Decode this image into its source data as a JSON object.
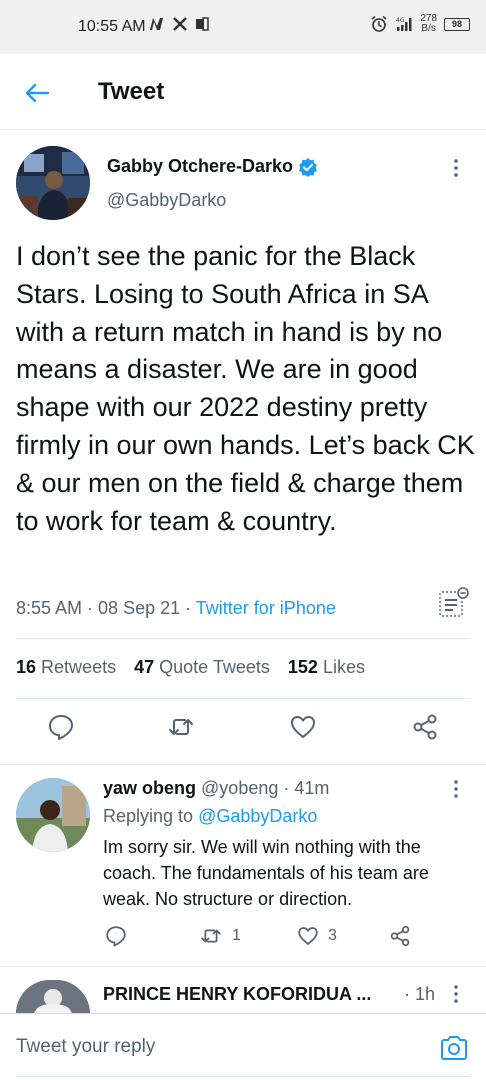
{
  "status_bar": {
    "time": "10:55 AM",
    "network_speed_value": "278",
    "network_speed_unit": "B/s",
    "battery": "98",
    "signal_label": "4G"
  },
  "header": {
    "title": "Tweet"
  },
  "tweet": {
    "author_name": "Gabby Otchere-Darko",
    "author_handle": "@GabbyDarko",
    "text": "I don’t see the panic for the Black Stars. Losing to South Africa in SA with a return match in hand is by no means a disaster. We are in good shape with our 2022 destiny pretty firmly in our own hands. Let’s back CK & our men on the field & charge them to work for team & country.",
    "time": "8:55 AM",
    "date": "08 Sep 21",
    "source": "Twitter for iPhone",
    "separator": " · ",
    "stats": {
      "retweets_count": "16",
      "retweets_label": "Retweets",
      "quotes_count": "47",
      "quotes_label": "Quote Tweets",
      "likes_count": "152",
      "likes_label": "Likes"
    }
  },
  "reply": {
    "name": "yaw obeng",
    "handle": "@yobeng",
    "time_ago": "41m",
    "replying_prefix": "Replying to",
    "replying_to": "@GabbyDarko",
    "text": "Im sorry sir. We will win nothing with the coach. The fundamentals of his team are weak. No structure or direction.",
    "retweets": "1",
    "likes": "3"
  },
  "next_reply": {
    "name": "PRINCE HENRY KOFORIDUA ...",
    "time_ago": "1h"
  },
  "compose": {
    "placeholder": "Tweet your reply"
  },
  "colors": {
    "accent": "#1d9bf0",
    "text_primary": "#0f1419",
    "text_secondary": "#536471"
  }
}
